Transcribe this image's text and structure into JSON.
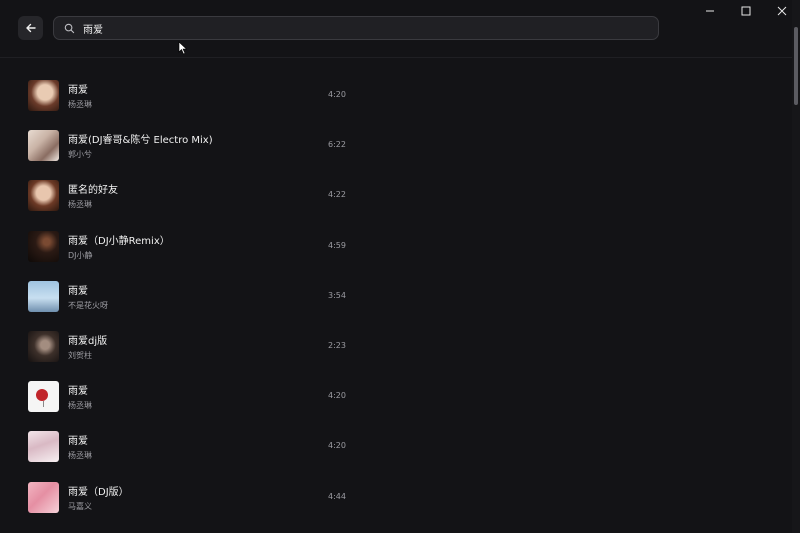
{
  "search": {
    "query": "雨爱"
  },
  "songs": [
    {
      "title": "雨爱",
      "artist": "杨丞琳",
      "duration": "4:20",
      "cover": "portrait-woman-dark-hair"
    },
    {
      "title": "雨爱(DJ睿哥&陈兮 Electro Mix)",
      "artist": "郭小兮",
      "duration": "6:22",
      "cover": "portrait-woman-light"
    },
    {
      "title": "匿名的好友",
      "artist": "杨丞琳",
      "duration": "4:22",
      "cover": "portrait-woman-dark-hair"
    },
    {
      "title": "雨爱（DJ小静Remix）",
      "artist": "DJ小静",
      "duration": "4:59",
      "cover": "dark-night-figure"
    },
    {
      "title": "雨爱",
      "artist": "不是花火呀",
      "duration": "3:54",
      "cover": "sky-blue-scene"
    },
    {
      "title": "雨爱dj版",
      "artist": "刘贺柱",
      "duration": "2:23",
      "cover": "dark-portrait"
    },
    {
      "title": "雨爱",
      "artist": "杨丞琳",
      "duration": "4:20",
      "cover": "white-red-umbrella"
    },
    {
      "title": "雨爱",
      "artist": "杨丞琳",
      "duration": "4:20",
      "cover": "portrait-woman-pink"
    },
    {
      "title": "雨爱（DJ版）",
      "artist": "马嘉义",
      "duration": "4:44",
      "cover": "anime-pink-hair"
    }
  ],
  "icons": {
    "back": "arrow-left-icon",
    "search": "search-icon",
    "minimize": "minimize-icon",
    "maximize": "maximize-icon",
    "close": "close-icon"
  }
}
